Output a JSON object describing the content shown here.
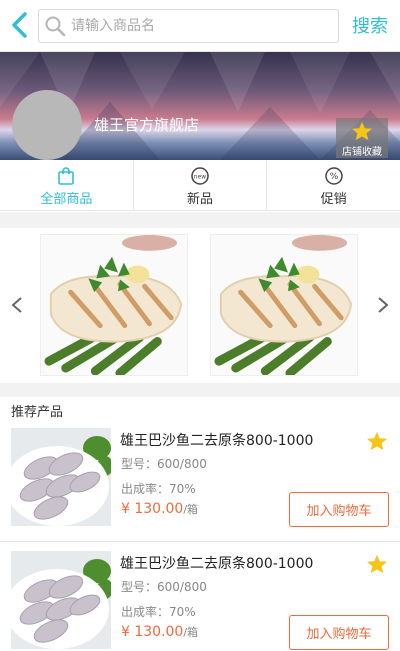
{
  "header": {
    "search_placeholder": "请输入商品名",
    "search_button": "搜索"
  },
  "shop": {
    "name": "雄王官方旗舰店",
    "favorite_label": "店铺收藏"
  },
  "tabs": [
    {
      "label": "全部商品",
      "icon": "bag-icon",
      "active": true
    },
    {
      "label": "新品",
      "icon": "new-icon",
      "active": false
    },
    {
      "label": "促销",
      "icon": "discount-icon",
      "active": false
    }
  ],
  "recommend_title": "推荐产品",
  "products": [
    {
      "name": "雄王巴沙鱼二去原条800-1000",
      "spec": "型号：600/800",
      "yield": "出成率：70%",
      "price": "¥ 130.00",
      "unit": "/箱",
      "cart": "加入购物车"
    },
    {
      "name": "雄王巴沙鱼二去原条800-1000",
      "spec": "型号：600/800",
      "yield": "出成率：70%",
      "price": "¥ 130.00",
      "unit": "/箱",
      "cart": "加入购物车"
    }
  ],
  "colors": {
    "accent": "#2fbfd0",
    "price": "#f06a3a",
    "star": "#f5c518"
  }
}
